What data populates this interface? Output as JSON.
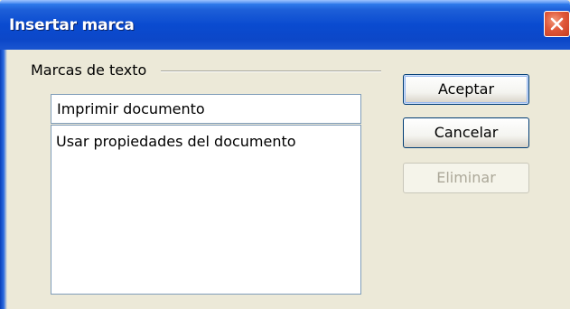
{
  "window": {
    "title": "Insertar marca",
    "close_icon": "close-icon"
  },
  "group": {
    "label": "Marcas de texto"
  },
  "bookmark_input": {
    "value": "Imprimir documento"
  },
  "bookmarks_list": {
    "items": [
      "Usar propiedades del documento"
    ]
  },
  "buttons": {
    "ok_label": "Aceptar",
    "cancel_label": "Cancelar",
    "delete_label": "Eliminar"
  },
  "colors": {
    "titlebar": "#0a4bd0",
    "close_button": "#e0583a",
    "dialog_background": "#ece9d8"
  }
}
